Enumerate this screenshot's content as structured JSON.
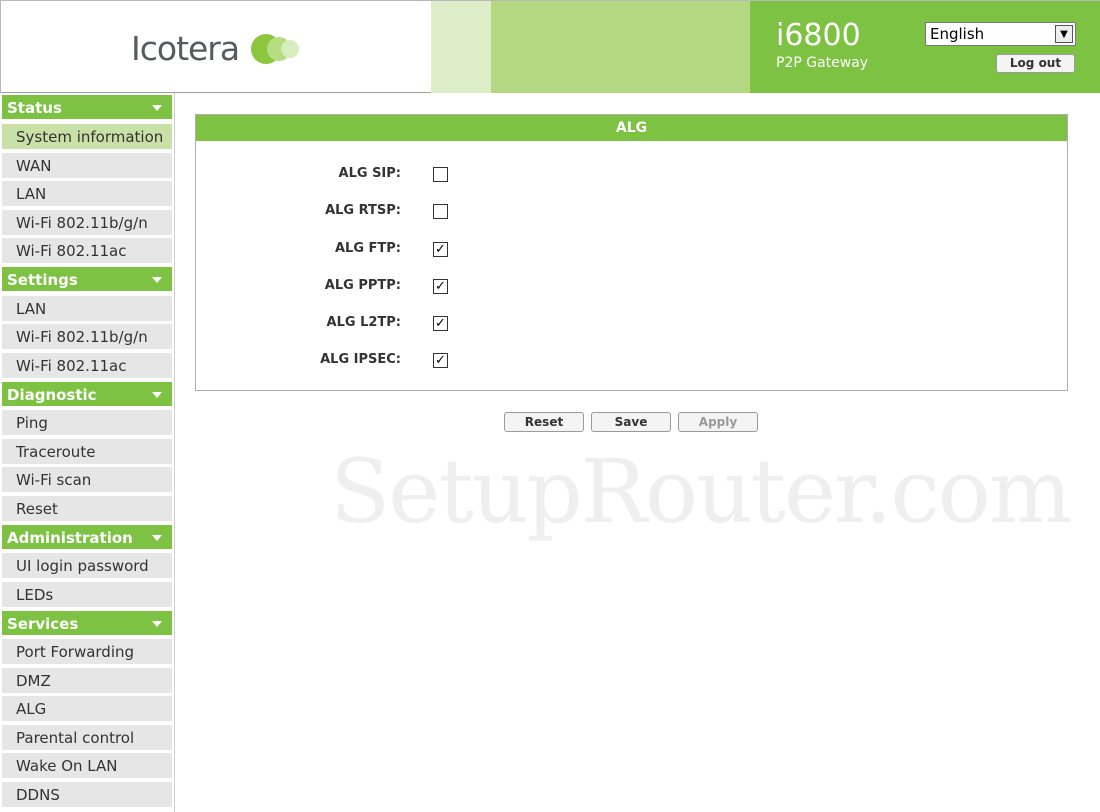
{
  "header": {
    "logo_text": "Icotera",
    "model": "i6800",
    "subtitle": "P2P Gateway",
    "language_selected": "English",
    "logout_label": "Log out"
  },
  "sidebar": {
    "sections": [
      {
        "title": "Status",
        "items": [
          "System information",
          "WAN",
          "LAN",
          "Wi-Fi 802.11b/g/n",
          "Wi-Fi 802.11ac"
        ]
      },
      {
        "title": "Settings",
        "items": [
          "LAN",
          "Wi-Fi 802.11b/g/n",
          "Wi-Fi 802.11ac"
        ]
      },
      {
        "title": "Diagnostic",
        "items": [
          "Ping",
          "Traceroute",
          "Wi-Fi scan",
          "Reset"
        ]
      },
      {
        "title": "Administration",
        "items": [
          "UI login password",
          "LEDs"
        ]
      },
      {
        "title": "Services",
        "items": [
          "Port Forwarding",
          "DMZ",
          "ALG",
          "Parental control",
          "Wake On LAN",
          "DDNS"
        ]
      }
    ],
    "active_item": "System information"
  },
  "panel": {
    "title": "ALG",
    "options": [
      {
        "label": "ALG SIP:",
        "checked": false
      },
      {
        "label": "ALG RTSP:",
        "checked": false
      },
      {
        "label": "ALG FTP:",
        "checked": true
      },
      {
        "label": "ALG PPTP:",
        "checked": true
      },
      {
        "label": "ALG L2TP:",
        "checked": true
      },
      {
        "label": "ALG IPSEC:",
        "checked": true
      }
    ]
  },
  "buttons": {
    "reset": "Reset",
    "save": "Save",
    "apply": "Apply"
  },
  "watermark": "SetupRouter.com",
  "colors": {
    "accent": "#7dc242",
    "active_item": "#c9e0a7",
    "nav_bg": "#e6e6e6"
  }
}
